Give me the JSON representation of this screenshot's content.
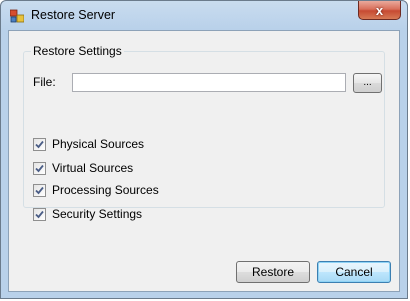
{
  "window": {
    "title": "Restore Server",
    "close_glyph": "x"
  },
  "group": {
    "legend": "Restore  Settings"
  },
  "file": {
    "label": "File:",
    "value": "",
    "browse_label": "..."
  },
  "options": [
    {
      "label": "Physical Sources",
      "checked": true
    },
    {
      "label": "Virtual Sources",
      "checked": true
    },
    {
      "label": "Processing Sources",
      "checked": true
    },
    {
      "label": "Security Settings",
      "checked": true
    }
  ],
  "buttons": {
    "restore": "Restore",
    "cancel": "Cancel"
  },
  "icons": {
    "app": "server-app-icon",
    "close": "close-icon",
    "check": "checkmark-icon"
  }
}
